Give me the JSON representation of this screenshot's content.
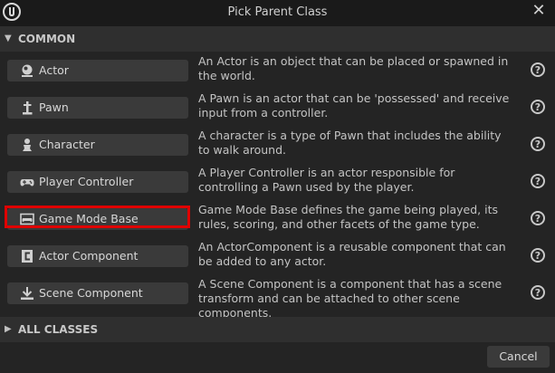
{
  "window": {
    "title": "Pick Parent Class",
    "close_glyph": "✕"
  },
  "sections": {
    "common": {
      "label": "COMMON",
      "expanded": true
    },
    "all_classes": {
      "label": "ALL CLASSES",
      "expanded": false
    }
  },
  "classes": [
    {
      "label": "Actor",
      "icon": "actor-sphere-icon",
      "description": "An Actor is an object that can be placed or spawned in the world."
    },
    {
      "label": "Pawn",
      "icon": "pawn-icon",
      "description": "A Pawn is an actor that can be 'possessed' and receive input from a controller."
    },
    {
      "label": "Character",
      "icon": "character-icon",
      "description": "A character is a type of Pawn that includes the ability to walk around."
    },
    {
      "label": "Player Controller",
      "icon": "gamepad-icon",
      "description": "A Player Controller is an actor responsible for controlling a Pawn used by the player."
    },
    {
      "label": "Game Mode Base",
      "icon": "game-mode-icon",
      "description": "Game Mode Base defines the game being played, its rules, scoring, and other facets of the game type.",
      "highlighted": true
    },
    {
      "label": "Actor Component",
      "icon": "actor-component-icon",
      "description": "An ActorComponent is a reusable component that can be added to any actor."
    },
    {
      "label": "Scene Component",
      "icon": "scene-component-icon",
      "description": "A Scene Component is a component that has a scene transform and can be attached to other scene components."
    }
  ],
  "help_glyph": "?",
  "footer": {
    "cancel_label": "Cancel"
  },
  "colors": {
    "highlight": "#e00000",
    "button_bg": "#3a3a3a",
    "panel_bg": "#242424"
  }
}
